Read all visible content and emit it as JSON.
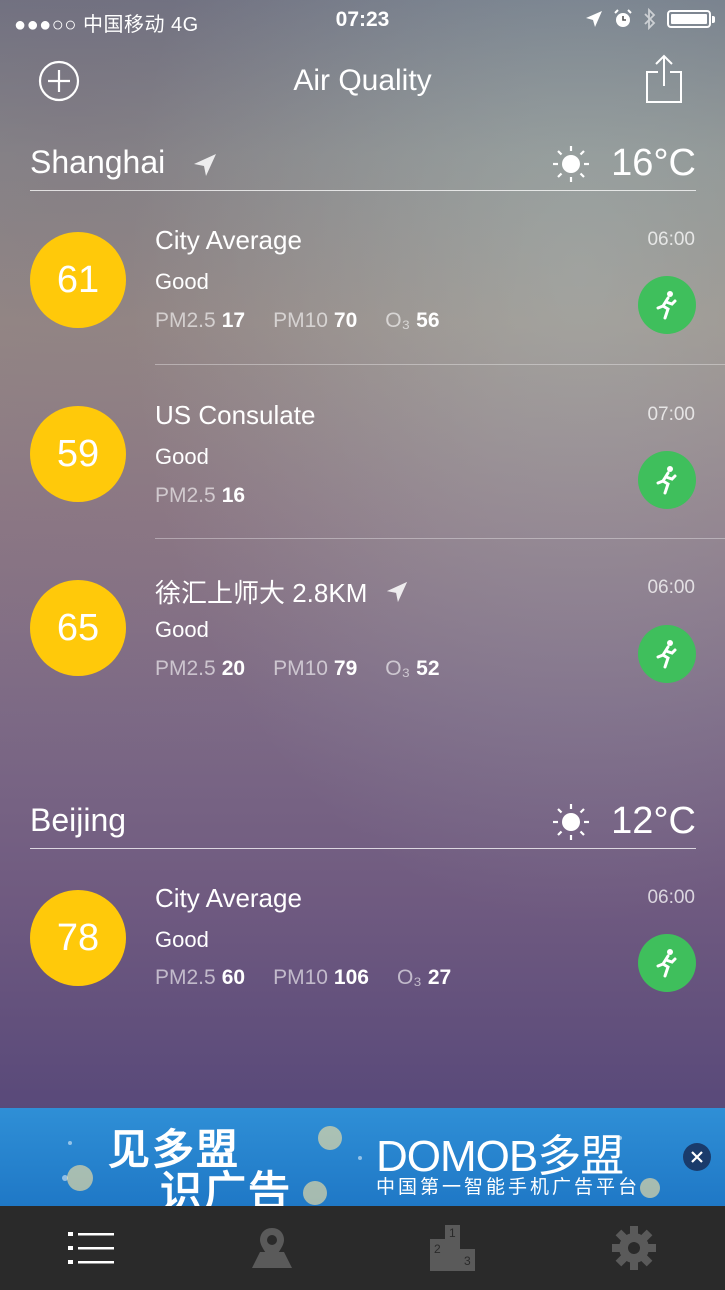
{
  "status_bar": {
    "carrier": "●●●○○ 中国移动  4G",
    "time": "07:23"
  },
  "nav": {
    "title": "Air Quality"
  },
  "cities": [
    {
      "name": "Shanghai",
      "temp": "16°C",
      "weather_icon": "sun-icon",
      "stations": [
        {
          "aqi": "61",
          "name": "City Average",
          "level": "Good",
          "time": "06:00",
          "metrics": [
            {
              "label": "PM2.5",
              "value": "17"
            },
            {
              "label": "PM10",
              "value": "70"
            },
            {
              "label": "O₃",
              "value": "56"
            }
          ]
        },
        {
          "aqi": "59",
          "name": "US Consulate",
          "level": "Good",
          "time": "07:00",
          "metrics": [
            {
              "label": "PM2.5",
              "value": "16"
            }
          ]
        },
        {
          "aqi": "65",
          "name": "徐汇上师大 2.8KM",
          "level": "Good",
          "time": "06:00",
          "metrics": [
            {
              "label": "PM2.5",
              "value": "20"
            },
            {
              "label": "PM10",
              "value": "79"
            },
            {
              "label": "O₃",
              "value": "52"
            }
          ]
        }
      ]
    },
    {
      "name": "Beijing",
      "temp": "12°C",
      "weather_icon": "sun-icon",
      "stations": [
        {
          "aqi": "78",
          "name": "City Average",
          "level": "Good",
          "time": "06:00",
          "metrics": [
            {
              "label": "PM2.5",
              "value": "60"
            },
            {
              "label": "PM10",
              "value": "106"
            },
            {
              "label": "O₃",
              "value": "27"
            }
          ]
        }
      ]
    }
  ],
  "ad": {
    "line1": "见多盟",
    "line2": "识广告",
    "brand": "DOMOB多盟",
    "tagline": "中国第一智能手机广告平台"
  },
  "tab_bar": {
    "tabs": [
      "list-icon",
      "map-icon",
      "ranking-icon",
      "settings-icon"
    ]
  },
  "colors": {
    "aqi_good": "#ffc90a",
    "run_green": "#3fbf5c",
    "tabbar_bg": "#2a2a2a",
    "ad_blue": "#2f8fd6"
  }
}
